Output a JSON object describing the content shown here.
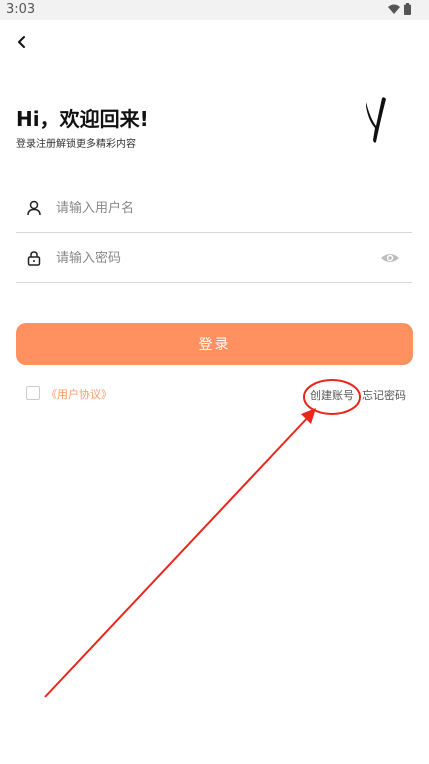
{
  "status_bar": {
    "time": "3:03",
    "icons": [
      "wifi-icon",
      "battery-icon"
    ]
  },
  "nav": {
    "back_icon": "back-arrow-icon"
  },
  "header": {
    "title": "Hi，欢迎回来!",
    "subtitle": "登录注册解锁更多精彩内容"
  },
  "form": {
    "username": {
      "placeholder": "请输入用户名",
      "value": "",
      "icon": "user-icon"
    },
    "password": {
      "placeholder": "请输入密码",
      "value": "",
      "icon": "lock-icon",
      "toggle_icon": "eye-icon"
    },
    "login_label": "登录"
  },
  "footer": {
    "agreement_label": "《用户协议》",
    "agreement_checked": false,
    "create_account_label": "创建账号",
    "forgot_password_label": "忘记密码"
  },
  "colors": {
    "accent": "#ff9160",
    "link": "#ff9a6a",
    "annotation": "#e8261c"
  }
}
